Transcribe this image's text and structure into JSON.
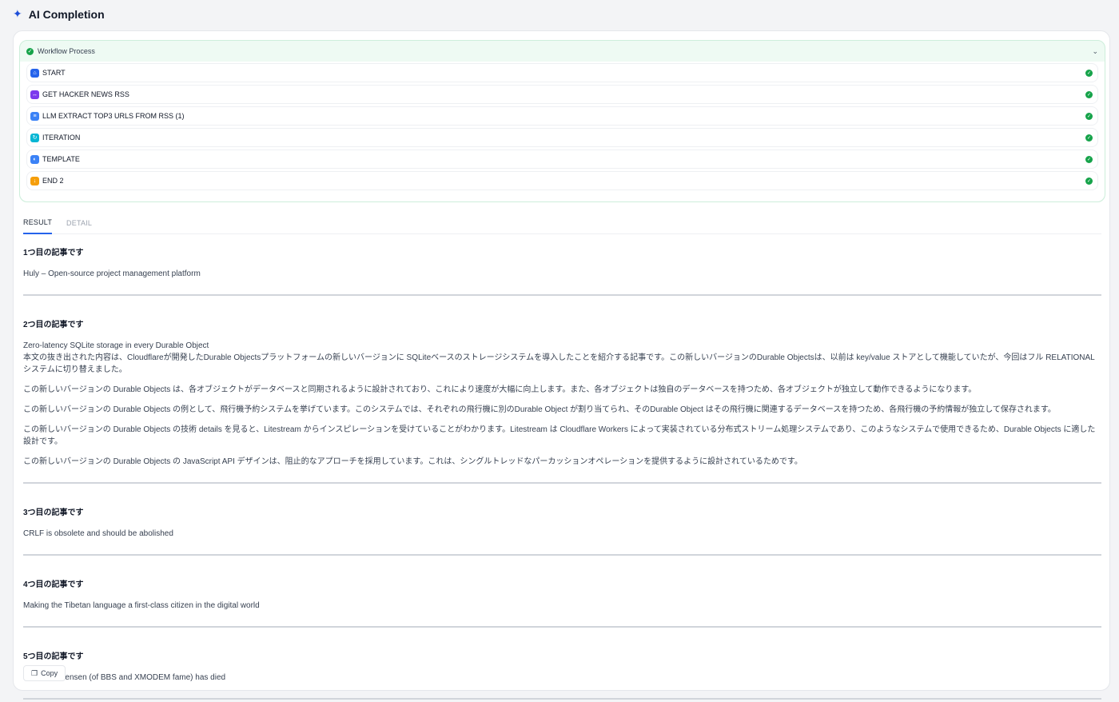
{
  "header": {
    "title": "AI Completion",
    "icon": "sparkle-icon"
  },
  "workflow": {
    "title": "Workflow Process",
    "nodes": [
      {
        "label": "START",
        "icon": "home-icon",
        "color": "#2563eb"
      },
      {
        "label": "GET HACKER NEWS RSS",
        "icon": "http-icon",
        "color": "#7c3aed"
      },
      {
        "label": "LLM EXTRACT TOP3 URLS FROM RSS (1)",
        "icon": "list-icon",
        "color": "#3b82f6"
      },
      {
        "label": "ITERATION",
        "icon": "loop-icon",
        "color": "#06b6d4"
      },
      {
        "label": "TEMPLATE",
        "icon": "template-icon",
        "color": "#3b82f6"
      },
      {
        "label": "END 2",
        "icon": "end-icon",
        "color": "#f59e0b"
      }
    ]
  },
  "tabs": {
    "result": "RESULT",
    "detail": "DETAIL"
  },
  "articles": [
    {
      "heading": "1つ目の記事です",
      "lines": [
        "Huly – Open-source project management platform"
      ]
    },
    {
      "heading": "2つ目の記事です",
      "lines": [
        "Zero-latency SQLite storage in every Durable Object",
        "本文の抜き出された内容は、Cloudflareが開発したDurable Objectsプラットフォームの新しいバージョンに SQLiteベースのストレージシステムを導入したことを紹介する記事です。この新しいバージョンのDurable Objectsは、以前は key/value ストアとして機能していたが、今回はフル RELATIONAL システムに切り替えました。",
        "この新しいバージョンの Durable Objects は、各オブジェクトがデータベースと同期されるように設計されており、これにより速度が大幅に向上します。また、各オブジェクトは独自のデータベースを持つため、各オブジェクトが独立して動作できるようになります。",
        "この新しいバージョンの Durable Objects の例として、飛行機予約システムを挙げています。このシステムでは、それぞれの飛行機に別のDurable Object が割り当てられ、そのDurable Object はその飛行機に関連するデータベースを持つため、各飛行機の予約情報が独立して保存されます。",
        "この新しいバージョンの Durable Objects の技術 details を見ると、Litestream からインスピレーションを受けていることがわかります。Litestream は Cloudflare Workers によって実装されている分布式ストリーム処理システムであり、このようなシステムで使用できるため、Durable Objects に適した設計です。",
        "この新しいバージョンの Durable Objects の JavaScript API デザインは、阻止的なアプローチを採用しています。これは、シングルトレッドなパーカッションオペレーションを提供するように設計されているためです。"
      ]
    },
    {
      "heading": "3つ目の記事です",
      "lines": [
        "CRLF is obsolete and should be abolished"
      ]
    },
    {
      "heading": "4つ目の記事です",
      "lines": [
        "Making the Tibetan language a first-class citizen in the digital world"
      ]
    },
    {
      "heading": "5つ目の記事です",
      "lines": [
        "Ward Christensen (of BBS and XMODEM fame) has died"
      ]
    }
  ],
  "copy": {
    "label": "Copy"
  }
}
